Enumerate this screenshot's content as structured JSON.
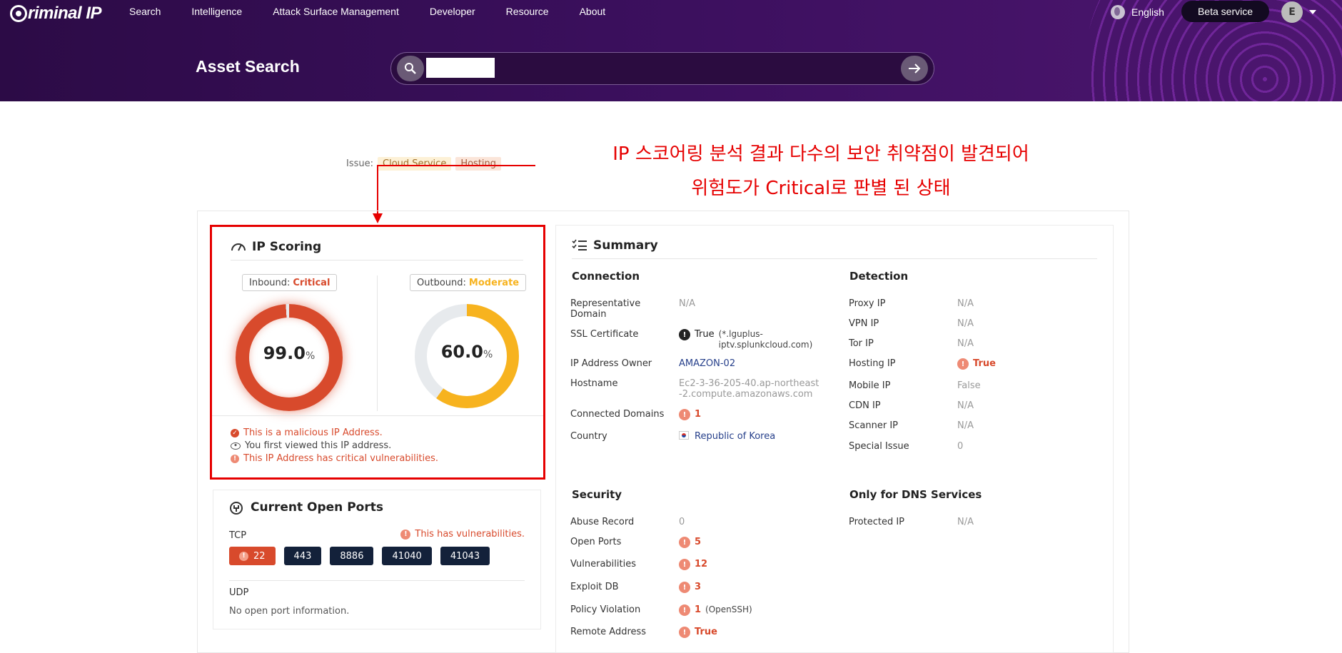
{
  "header": {
    "logo_text": "riminal IP",
    "nav": [
      "Search",
      "Intelligence",
      "Attack Surface Management",
      "Developer",
      "Resource",
      "About"
    ],
    "language": "English",
    "beta_label": "Beta service",
    "avatar_initial": "E",
    "page_title": "Asset Search",
    "search_value": ""
  },
  "annotation": {
    "issue_label": "Issue:",
    "issue_chips": [
      "Cloud Service",
      "Hosting"
    ],
    "line1": "IP 스코어링 분석 결과 다수의 보안 취약점이 발견되어",
    "line2": "위험도가 Critical로 판별 된 상태"
  },
  "ip_scoring": {
    "title": "IP Scoring",
    "inbound_label": "Inbound:",
    "inbound_level": "Critical",
    "inbound_score": "99.0",
    "inbound_fraction": 0.99,
    "outbound_label": "Outbound:",
    "outbound_level": "Moderate",
    "outbound_score": "60.0",
    "outbound_fraction": 0.6,
    "percent_sign": "%",
    "messages": [
      "This is a malicious IP Address.",
      "You first viewed this IP address.",
      "This IP Address has critical vulnerabilities."
    ]
  },
  "open_ports": {
    "title": "Current Open Ports",
    "tcp_label": "TCP",
    "vuln_note": "This has vulnerabilities.",
    "tcp_ports": [
      "22",
      "443",
      "8886",
      "41040",
      "41043"
    ],
    "udp_label": "UDP",
    "udp_empty": "No open port information."
  },
  "summary": {
    "title": "Summary",
    "connection": {
      "title": "Connection",
      "representative_domain": {
        "label": "Representative Domain",
        "value": "N/A"
      },
      "ssl": {
        "label": "SSL Certificate",
        "value": "True",
        "detail": "(*.lguplus-iptv.splunkcloud.com)"
      },
      "owner": {
        "label": "IP Address Owner",
        "value": "AMAZON-02"
      },
      "hostname": {
        "label": "Hostname",
        "value": "Ec2-3-36-205-40.ap-northeast-2.compute.amazonaws.com"
      },
      "connected_domains": {
        "label": "Connected Domains",
        "value": "1"
      },
      "country": {
        "label": "Country",
        "value": "Republic of Korea"
      }
    },
    "detection": {
      "title": "Detection",
      "proxy": {
        "label": "Proxy IP",
        "value": "N/A"
      },
      "vpn": {
        "label": "VPN IP",
        "value": "N/A"
      },
      "tor": {
        "label": "Tor IP",
        "value": "N/A"
      },
      "hosting": {
        "label": "Hosting IP",
        "value": "True"
      },
      "mobile": {
        "label": "Mobile IP",
        "value": "False"
      },
      "cdn": {
        "label": "CDN IP",
        "value": "N/A"
      },
      "scanner": {
        "label": "Scanner IP",
        "value": "N/A"
      },
      "special": {
        "label": "Special Issue",
        "value": "0"
      }
    },
    "security": {
      "title": "Security",
      "abuse": {
        "label": "Abuse Record",
        "value": "0"
      },
      "open_ports": {
        "label": "Open Ports",
        "value": "5"
      },
      "vulns": {
        "label": "Vulnerabilities",
        "value": "12"
      },
      "exploit": {
        "label": "Exploit DB",
        "value": "3"
      },
      "policy": {
        "label": "Policy Violation",
        "value": "1",
        "detail": "(OpenSSH)"
      },
      "remote": {
        "label": "Remote Address",
        "value": "True"
      }
    },
    "dns": {
      "title": "Only for DNS Services",
      "protected": {
        "label": "Protected IP",
        "value": "N/A"
      }
    }
  },
  "colors": {
    "critical": "#d84a2c",
    "moderate": "#f7b31f",
    "annotation": "#e60000",
    "header_bg": "#3a0f5c"
  }
}
